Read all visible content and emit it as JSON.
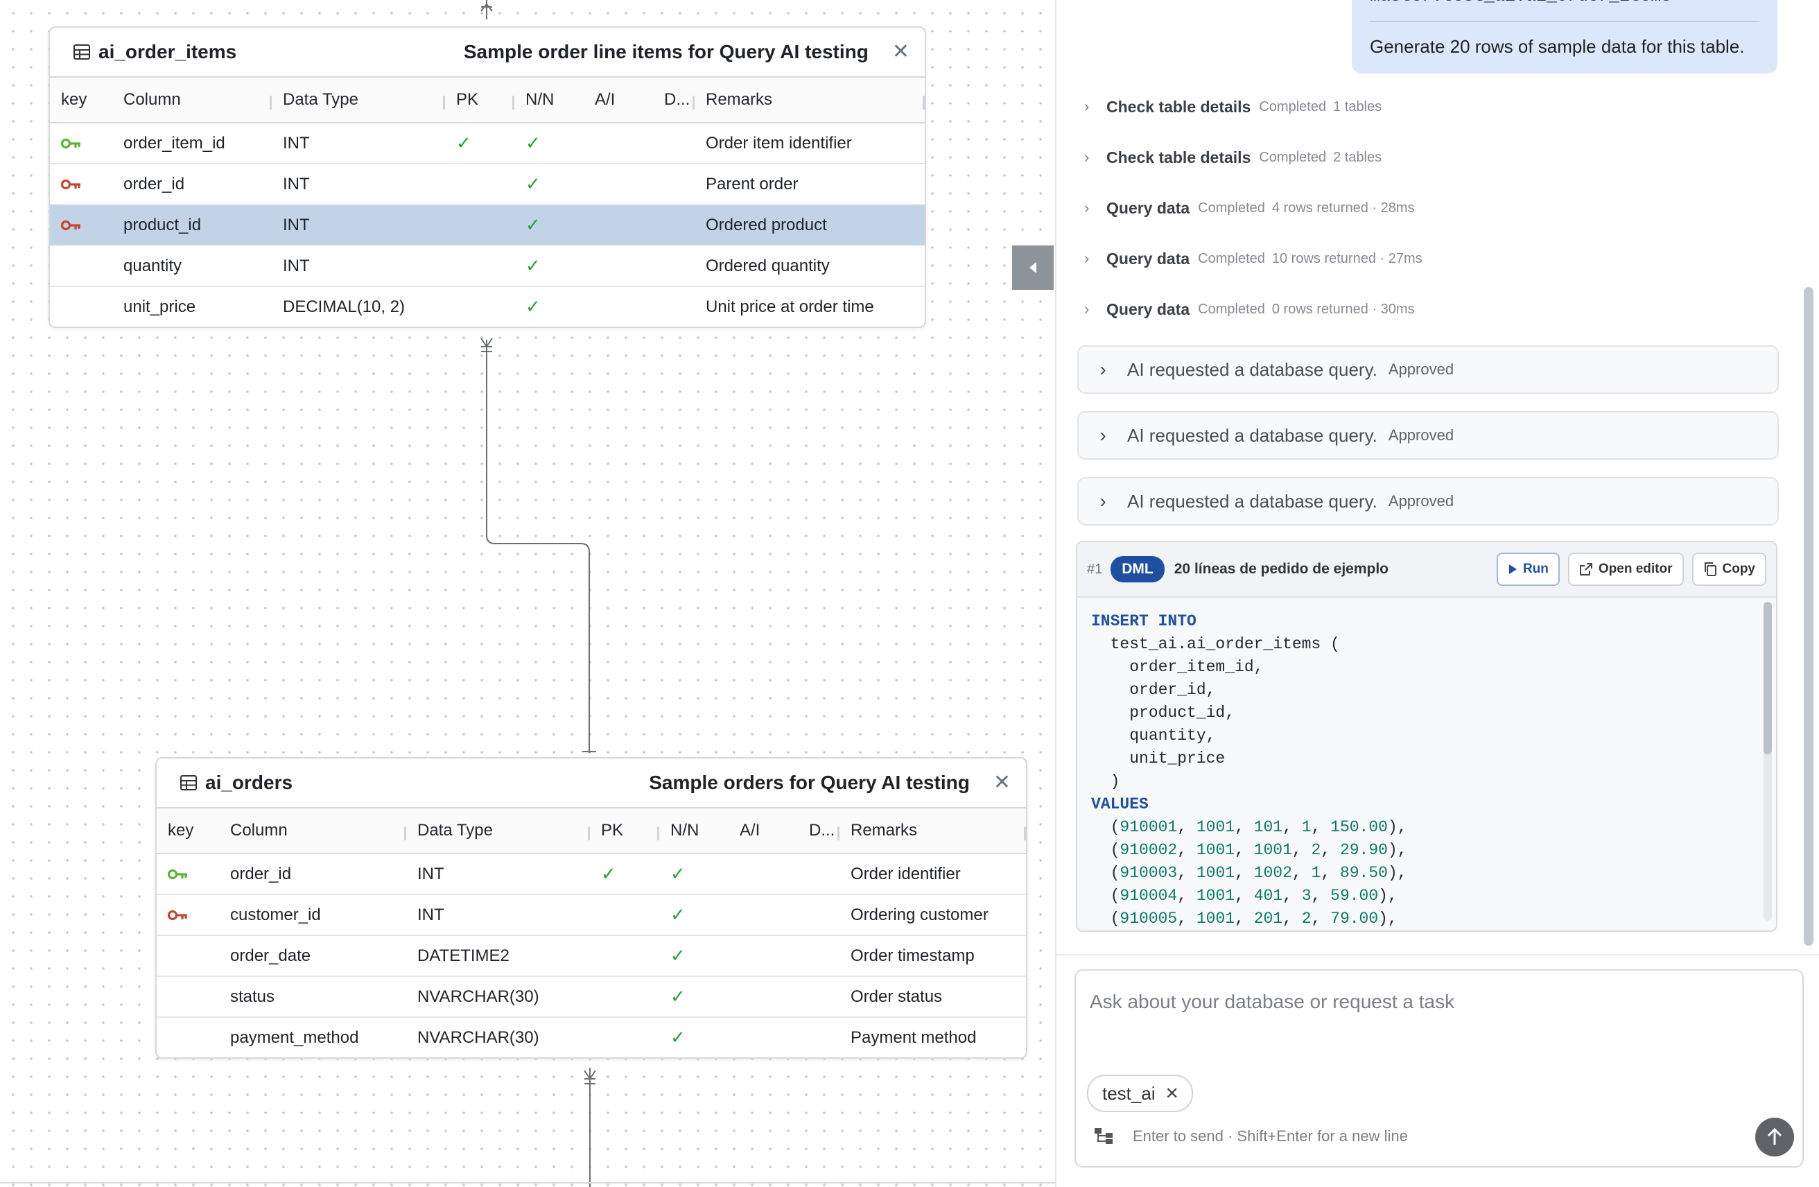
{
  "tables": [
    {
      "name": "ai_order_items",
      "description": "Sample order line items for Query AI testing",
      "close": "✕",
      "headers": [
        "key",
        "Column",
        "Data Type",
        "PK",
        "N/N",
        "A/I",
        "D...",
        "Remarks"
      ],
      "rows": [
        {
          "key": "primary",
          "column": "order_item_id",
          "type": "INT",
          "pk": "✓",
          "nn": "✓",
          "ai": "",
          "def": "",
          "remarks": "Order item identifier",
          "selected": false
        },
        {
          "key": "foreign",
          "column": "order_id",
          "type": "INT",
          "pk": "",
          "nn": "✓",
          "ai": "",
          "def": "",
          "remarks": "Parent order",
          "selected": false
        },
        {
          "key": "foreign",
          "column": "product_id",
          "type": "INT",
          "pk": "",
          "nn": "✓",
          "ai": "",
          "def": "",
          "remarks": "Ordered product",
          "selected": true
        },
        {
          "key": "",
          "column": "quantity",
          "type": "INT",
          "pk": "",
          "nn": "✓",
          "ai": "",
          "def": "",
          "remarks": "Ordered quantity",
          "selected": false
        },
        {
          "key": "",
          "column": "unit_price",
          "type": "DECIMAL(10, 2)",
          "pk": "",
          "nn": "✓",
          "ai": "",
          "def": "",
          "remarks": "Unit price at order time",
          "selected": false
        }
      ]
    },
    {
      "name": "ai_orders",
      "description": "Sample orders for Query AI testing",
      "close": "✕",
      "headers": [
        "key",
        "Column",
        "Data Type",
        "PK",
        "N/N",
        "A/I",
        "D...",
        "Remarks"
      ],
      "rows": [
        {
          "key": "primary",
          "column": "order_id",
          "type": "INT",
          "pk": "✓",
          "nn": "✓",
          "ai": "",
          "def": "",
          "remarks": "Order identifier",
          "selected": false
        },
        {
          "key": "foreign",
          "column": "customer_id",
          "type": "INT",
          "pk": "",
          "nn": "✓",
          "ai": "",
          "def": "",
          "remarks": "Ordering customer",
          "selected": false
        },
        {
          "key": "",
          "column": "order_date",
          "type": "DATETIME2",
          "pk": "",
          "nn": "✓",
          "ai": "",
          "def": "",
          "remarks": "Order timestamp",
          "selected": false
        },
        {
          "key": "",
          "column": "status",
          "type": "NVARCHAR(30)",
          "pk": "",
          "nn": "✓",
          "ai": "",
          "def": "",
          "remarks": "Order status",
          "selected": false
        },
        {
          "key": "",
          "column": "payment_method",
          "type": "NVARCHAR(30)",
          "pk": "",
          "nn": "✓",
          "ai": "",
          "def": "",
          "remarks": "Payment method",
          "selected": false
        }
      ]
    }
  ],
  "colors": {
    "primary_key": "#5cb531",
    "foreign_key": "#c8452f",
    "check": "#22a33a",
    "selected_row": "#c2d3e8",
    "accent": "#1f4fa3"
  },
  "chat": {
    "user_prev_line": "master.test_ai.ai_order_items",
    "user_message": "Generate 20 rows of sample data for this table.",
    "steps": [
      {
        "title": "Check table details",
        "status": "Completed",
        "detail": "1 tables"
      },
      {
        "title": "Check table details",
        "status": "Completed",
        "detail": "2 tables"
      },
      {
        "title": "Query data",
        "status": "Completed",
        "detail": "4 rows returned · 28ms"
      },
      {
        "title": "Query data",
        "status": "Completed",
        "detail": "10 rows returned · 27ms"
      },
      {
        "title": "Query data",
        "status": "Completed",
        "detail": "0 rows returned · 30ms"
      }
    ],
    "approvals": [
      {
        "text": "AI requested a database query.",
        "status": "Approved"
      },
      {
        "text": "AI requested a database query.",
        "status": "Approved"
      },
      {
        "text": "AI requested a database query.",
        "status": "Approved"
      }
    ],
    "sql_card": {
      "number": "#1",
      "badge": "DML",
      "title": "20 líneas de pedido de ejemplo",
      "run_label": "Run",
      "open_editor_label": "Open editor",
      "copy_label": "Copy",
      "lines": [
        [
          {
            "t": "INSERT INTO",
            "c": "kw"
          }
        ],
        [
          {
            "t": "  test_ai.ai_order_items (",
            "c": ""
          }
        ],
        [
          {
            "t": "    order_item_id,",
            "c": ""
          }
        ],
        [
          {
            "t": "    order_id,",
            "c": ""
          }
        ],
        [
          {
            "t": "    product_id,",
            "c": ""
          }
        ],
        [
          {
            "t": "    quantity,",
            "c": ""
          }
        ],
        [
          {
            "t": "    unit_price",
            "c": ""
          }
        ],
        [
          {
            "t": "  )",
            "c": ""
          }
        ],
        [
          {
            "t": "VALUES",
            "c": "kw"
          }
        ],
        [
          {
            "t": "  (",
            "c": ""
          },
          {
            "t": "910001",
            "c": "num"
          },
          {
            "t": ", ",
            "c": ""
          },
          {
            "t": "1001",
            "c": "num"
          },
          {
            "t": ", ",
            "c": ""
          },
          {
            "t": "101",
            "c": "num"
          },
          {
            "t": ", ",
            "c": ""
          },
          {
            "t": "1",
            "c": "num"
          },
          {
            "t": ", ",
            "c": ""
          },
          {
            "t": "150.00",
            "c": "num"
          },
          {
            "t": "),",
            "c": ""
          }
        ],
        [
          {
            "t": "  (",
            "c": ""
          },
          {
            "t": "910002",
            "c": "num"
          },
          {
            "t": ", ",
            "c": ""
          },
          {
            "t": "1001",
            "c": "num"
          },
          {
            "t": ", ",
            "c": ""
          },
          {
            "t": "1001",
            "c": "num"
          },
          {
            "t": ", ",
            "c": ""
          },
          {
            "t": "2",
            "c": "num"
          },
          {
            "t": ", ",
            "c": ""
          },
          {
            "t": "29.90",
            "c": "num"
          },
          {
            "t": "),",
            "c": ""
          }
        ],
        [
          {
            "t": "  (",
            "c": ""
          },
          {
            "t": "910003",
            "c": "num"
          },
          {
            "t": ", ",
            "c": ""
          },
          {
            "t": "1001",
            "c": "num"
          },
          {
            "t": ", ",
            "c": ""
          },
          {
            "t": "1002",
            "c": "num"
          },
          {
            "t": ", ",
            "c": ""
          },
          {
            "t": "1",
            "c": "num"
          },
          {
            "t": ", ",
            "c": ""
          },
          {
            "t": "89.50",
            "c": "num"
          },
          {
            "t": "),",
            "c": ""
          }
        ],
        [
          {
            "t": "  (",
            "c": ""
          },
          {
            "t": "910004",
            "c": "num"
          },
          {
            "t": ", ",
            "c": ""
          },
          {
            "t": "1001",
            "c": "num"
          },
          {
            "t": ", ",
            "c": ""
          },
          {
            "t": "401",
            "c": "num"
          },
          {
            "t": ", ",
            "c": ""
          },
          {
            "t": "3",
            "c": "num"
          },
          {
            "t": ", ",
            "c": ""
          },
          {
            "t": "59.00",
            "c": "num"
          },
          {
            "t": "),",
            "c": ""
          }
        ],
        [
          {
            "t": "  (",
            "c": ""
          },
          {
            "t": "910005",
            "c": "num"
          },
          {
            "t": ", ",
            "c": ""
          },
          {
            "t": "1001",
            "c": "num"
          },
          {
            "t": ", ",
            "c": ""
          },
          {
            "t": "201",
            "c": "num"
          },
          {
            "t": ", ",
            "c": ""
          },
          {
            "t": "2",
            "c": "num"
          },
          {
            "t": ", ",
            "c": ""
          },
          {
            "t": "79.00",
            "c": "num"
          },
          {
            "t": "),",
            "c": ""
          }
        ]
      ]
    },
    "composer": {
      "placeholder": "Ask about your database or request a task",
      "chip_label": "test_ai",
      "chip_close": "✕",
      "hint": "Enter to send · Shift+Enter for a new line"
    }
  }
}
